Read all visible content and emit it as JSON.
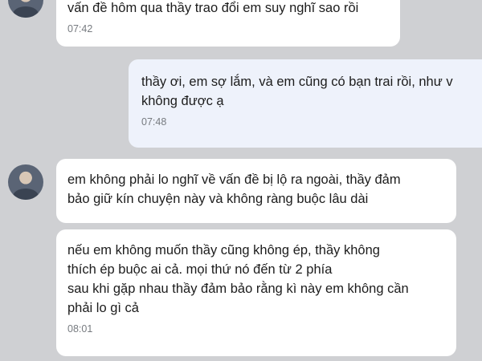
{
  "messages": [
    {
      "id": "m1",
      "side": "incoming",
      "lines": [
        "vấn đề hôm qua thầy trao đổi em suy nghĩ sao rồi"
      ],
      "time": "07:42"
    },
    {
      "id": "m2",
      "side": "outgoing",
      "lines": [
        "thầy ơi, em sợ lắm, và em cũng có  bạn trai rồi, như v",
        "không được ạ"
      ],
      "time": "07:48"
    },
    {
      "id": "m3",
      "side": "incoming",
      "lines": [
        "em không phải lo nghĩ về vấn đề bị lộ ra ngoài, thầy đảm",
        "bảo giữ kín chuyện này và không ràng buộc lâu dài"
      ],
      "time": ""
    },
    {
      "id": "m4",
      "side": "incoming",
      "lines": [
        "nếu em không muốn thầy cũng không ép, thầy không",
        "thích ép buộc ai cả. mọi thứ nó đến từ 2 phía",
        "sau khi gặp nhau thầy đảm bảo rằng kì này em không cần",
        "phải lo  gì cả"
      ],
      "time": "08:01"
    }
  ]
}
